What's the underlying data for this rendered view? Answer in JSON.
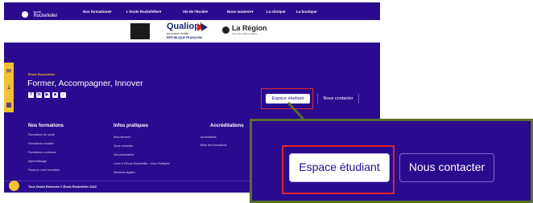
{
  "nav": {
    "logo_small": "école",
    "logo_name": "Rockefeller",
    "items": [
      "Nos formations▾",
      "L'école Rockefeller▾",
      "Vie de l'École▾",
      "Nous soutenir▾",
      "La clinique",
      "La boutique"
    ]
  },
  "partners": {
    "qualiopi": "Qualiopi",
    "qualiopi_sub": "processus certifié",
    "qualiopi_rep": "RÉPUBLIQUE FRANÇAISE",
    "region": "La Région",
    "region_sub": "Auvergne-Rhône-Alpes"
  },
  "footer_top": {
    "eyebrow": "École Rockefeller",
    "tagline": "Former, Accompagner, Innover",
    "socials": [
      "f",
      "in",
      "▶",
      "◙",
      "♪"
    ],
    "btn_espace": "Espace étudiant",
    "btn_contact": "Nous contacter"
  },
  "columns": [
    {
      "head": "Nos formations",
      "links": [
        "Formations de santé",
        "Formations sociales",
        "Formations continues",
        "Apprentissage",
        "Financer votre formation"
      ]
    },
    {
      "head": "Infos pratiques",
      "links": [
        "Recrutement",
        "Nous contacter",
        "Nos partenaires",
        "Louer à l'École Rockefeller - Infos Pratiques",
        "Mentions légales"
      ]
    },
    {
      "head": "Accréditations",
      "links": [
        "Accessibilité",
        "Bilan des formations"
      ]
    }
  ],
  "copyright": "Tous Droits Réservés © École Rockefeller 2022",
  "zoom": {
    "btn_espace": "Espace étudiant",
    "btn_contact": "Nous contacter"
  },
  "colors": {
    "brand_purple": "#2a0b8f",
    "accent_yellow": "#f2c230",
    "highlight_red": "#e0242b",
    "arrow_green": "#5a6e2a"
  }
}
